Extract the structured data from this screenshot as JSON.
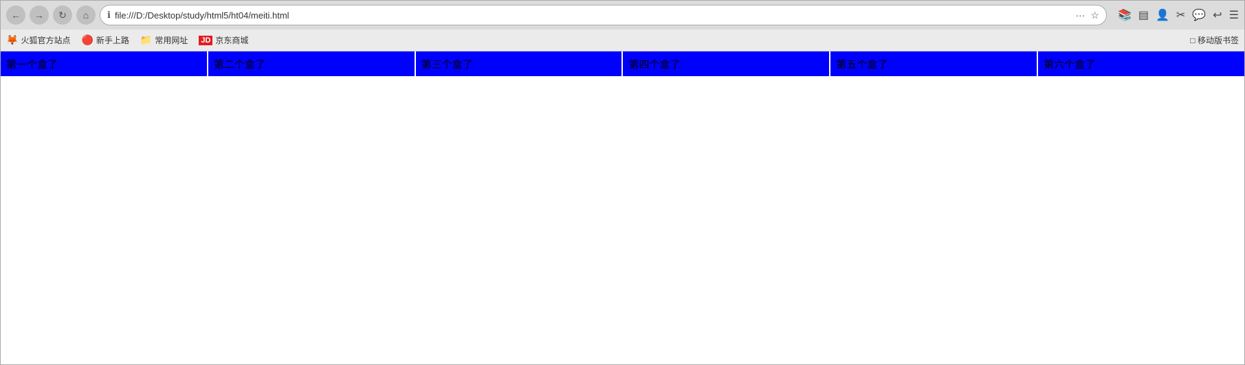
{
  "browser": {
    "url": "file:///D:/Desktop/study/html5/ht04/meiti.html",
    "back_label": "←",
    "forward_label": "→",
    "refresh_label": "↻",
    "home_label": "⌂",
    "more_label": "···",
    "star_label": "☆",
    "mobile_bookmarks_label": "□ 移动版书签"
  },
  "bookmarks": [
    {
      "id": "huhu",
      "icon": "🦊",
      "label": "火狐官方站点"
    },
    {
      "id": "xinshou",
      "icon": "🔴",
      "label": "新手上路"
    },
    {
      "id": "changyong",
      "icon": "📁",
      "label": "常用网址"
    },
    {
      "id": "jd",
      "icon": "JD",
      "label": "京东商城"
    }
  ],
  "boxes": [
    {
      "id": "box1",
      "label": "第一个盒了"
    },
    {
      "id": "box2",
      "label": "第二个盒了"
    },
    {
      "id": "box3",
      "label": "第三个盒了"
    },
    {
      "id": "box4",
      "label": "第四个盒了"
    },
    {
      "id": "box5",
      "label": "第五个盒了"
    },
    {
      "id": "box6",
      "label": "第六个盒了"
    }
  ]
}
